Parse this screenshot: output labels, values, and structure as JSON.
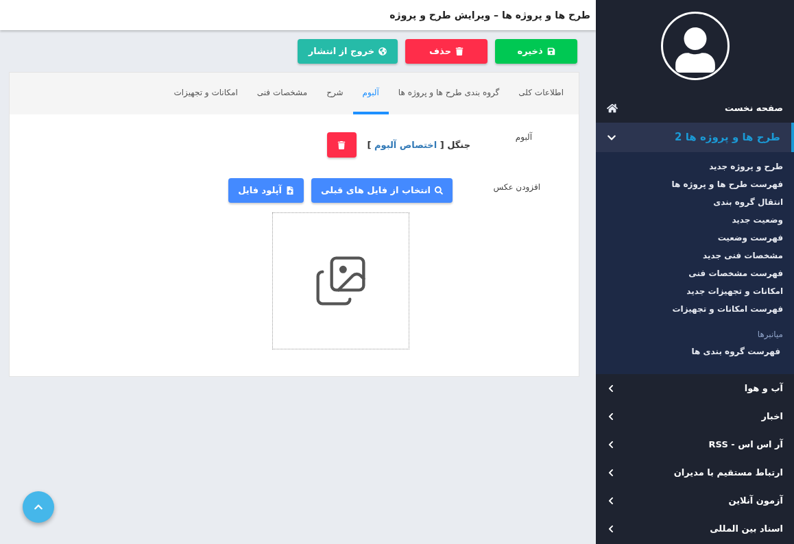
{
  "header": {
    "title": "طرح ها و پروژه ها – ویرایش طرح و پروژه"
  },
  "actions": [
    {
      "label": "ذخیره",
      "kind": "save"
    },
    {
      "label": "حذف",
      "kind": "delete"
    },
    {
      "label": "خروج از انتشار",
      "kind": "unpublish"
    }
  ],
  "tabs": [
    {
      "label": "اطلاعات کلی",
      "selected": false
    },
    {
      "label": "گروه بندی طرح ها و پروژه ها",
      "selected": false
    },
    {
      "label": "آلبوم",
      "selected": true
    },
    {
      "label": "شرح",
      "selected": false
    },
    {
      "label": "مشخصات فنی",
      "selected": false
    },
    {
      "label": "امکانات و تجهیزات",
      "selected": false
    }
  ],
  "album": {
    "label": "آلبوم",
    "text_before": "جنگل [",
    "link": "اختصاص آلبوم",
    "text_after": "]"
  },
  "add_photo": {
    "label": "افزودن عکس",
    "buttons": [
      {
        "label": "انتخاب از فایل های قبلی",
        "kind": "browse"
      },
      {
        "label": "آپلود فایل",
        "kind": "upload"
      }
    ]
  },
  "sidebar": {
    "items": [
      {
        "label": "صفحه نخست",
        "kind": "home"
      },
      {
        "label": "طرح ها و پروژه ها 2",
        "kind": "group",
        "expanded": true,
        "children": [
          "طرح و پروژه جدید",
          "فهرست طرح ها و پروژه ها",
          "انتقال گروه بندی",
          "وضعیت جدید",
          "فهرست وضعیت",
          "مشخصات فنی جدید",
          "فهرست مشخصات فنی",
          "امکانات و تجهیزات جدید",
          "فهرست امکانات و تجهیزات"
        ],
        "shortcuts_title": "میانبرها",
        "shortcuts": [
          "فهرست گروه بندی ها"
        ]
      },
      {
        "label": "آب و هوا",
        "kind": "group",
        "expanded": false
      },
      {
        "label": "اخبار",
        "kind": "group",
        "expanded": false
      },
      {
        "label": "آر اس اس - RSS",
        "kind": "group",
        "expanded": false
      },
      {
        "label": "ارتباط مستقیم با مدیران",
        "kind": "group",
        "expanded": false
      },
      {
        "label": "آزمون آنلاین",
        "kind": "group",
        "expanded": false
      },
      {
        "label": "اسناد بین المللی",
        "kind": "group",
        "expanded": false
      }
    ]
  }
}
